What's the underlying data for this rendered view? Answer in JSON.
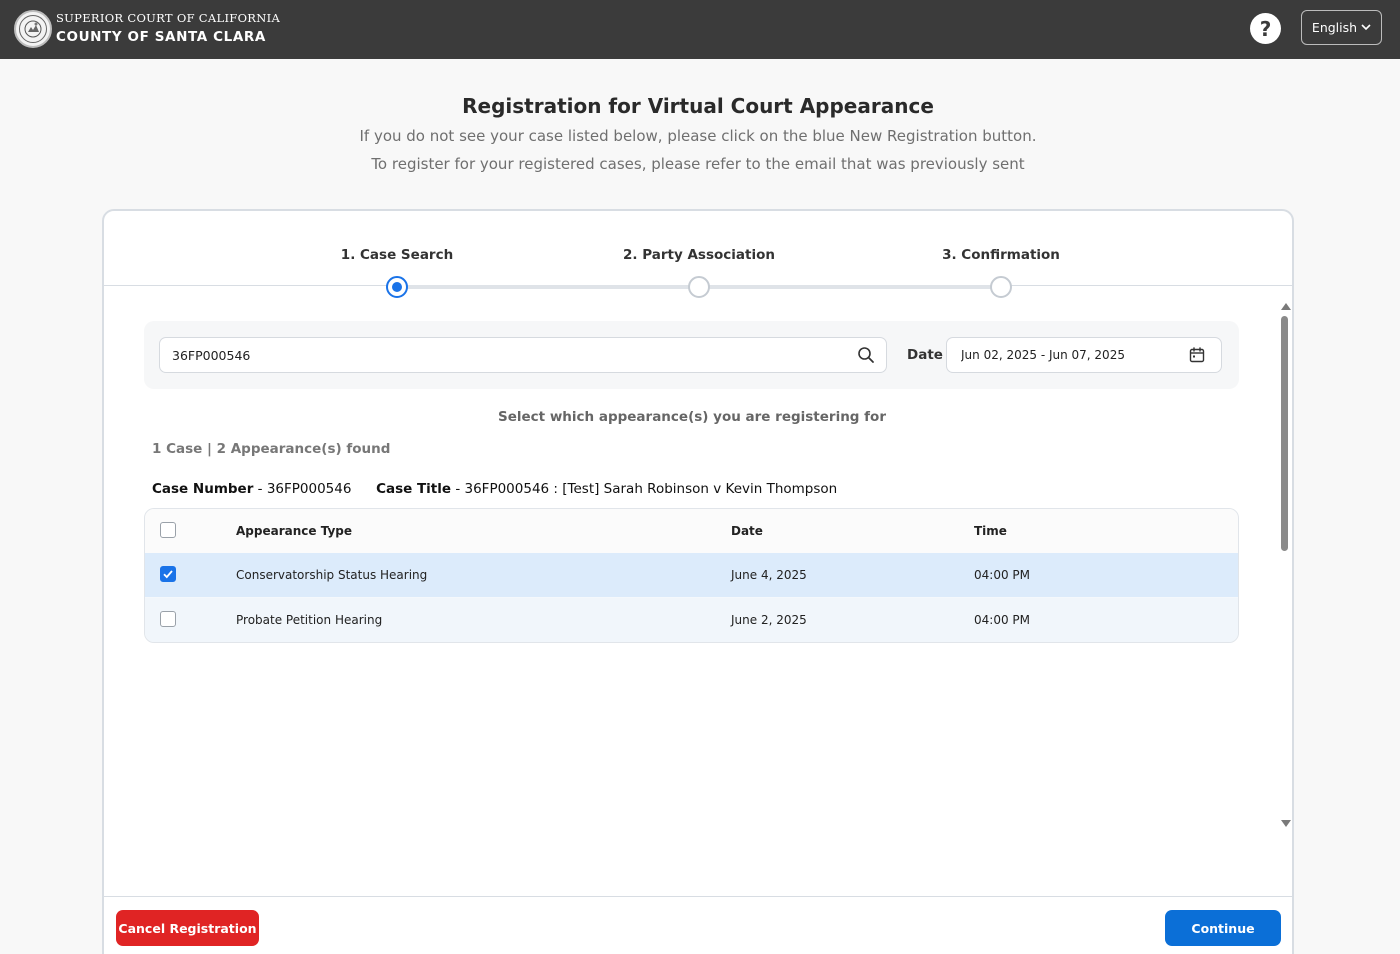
{
  "header": {
    "court_line": "SUPERIOR COURT OF CALIFORNIA",
    "county_line": "COUNTY OF SANTA CLARA",
    "help_icon": "?",
    "language": "English"
  },
  "page": {
    "title": "Registration for Virtual Court Appearance",
    "subtitle_line1": "If you do not see your case listed below, please click on the blue New Registration button.",
    "subtitle_line2": "To register for your registered cases, please refer to the email that was previously sent"
  },
  "steps": [
    {
      "label": "1. Case Search",
      "active": true
    },
    {
      "label": "2. Party Association",
      "active": false
    },
    {
      "label": "3. Confirmation",
      "active": false
    }
  ],
  "search": {
    "case_value": "36FP000546",
    "date_label": "Date",
    "date_range": "Jun 02, 2025 - Jun 07, 2025"
  },
  "results": {
    "instruction": "Select which appearance(s) you are registering for",
    "found_text": "1 Case | 2 Appearance(s) found",
    "case_number_label": "Case Number",
    "case_number_value": "- 36FP000546",
    "case_title_label": "Case Title",
    "case_title_value": "- 36FP000546 : [Test] Sarah Robinson v Kevin Thompson"
  },
  "table": {
    "columns": [
      "Appearance Type",
      "Date",
      "Time"
    ],
    "rows": [
      {
        "type": "Conservatorship Status Hearing",
        "date": "June 4, 2025",
        "time": "04:00 PM",
        "checked": true
      },
      {
        "type": "Probate Petition Hearing",
        "date": "June 2, 2025",
        "time": "04:00 PM",
        "checked": false
      }
    ]
  },
  "footer": {
    "cancel_label": "Cancel Registration",
    "continue_label": "Continue"
  },
  "colors": {
    "header_bg": "#3b3b3b",
    "accent_blue": "#1a73e8",
    "continue_blue": "#0b6fd7",
    "cancel_red": "#e02424",
    "selected_row": "#dcebfb"
  }
}
